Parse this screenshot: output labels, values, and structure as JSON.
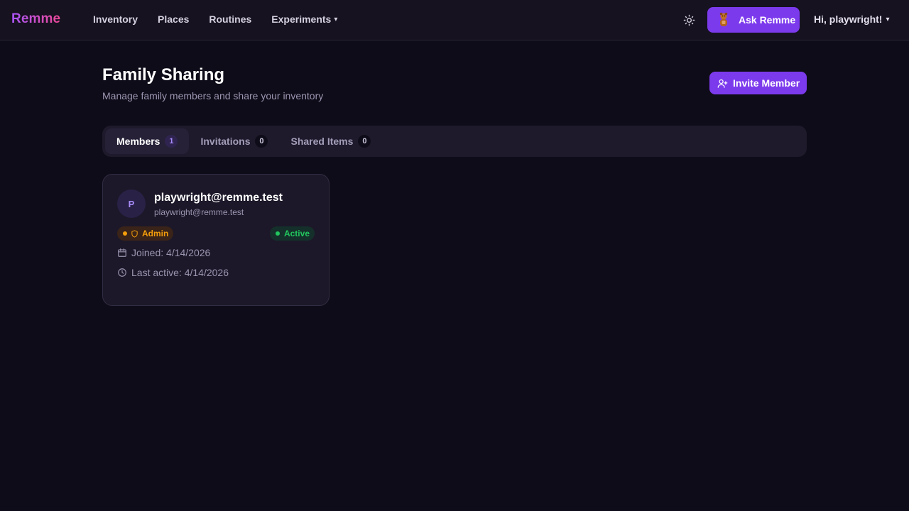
{
  "nav": {
    "brand": "Remme",
    "links": [
      {
        "label": "Inventory"
      },
      {
        "label": "Places"
      },
      {
        "label": "Routines"
      },
      {
        "label": "Experiments",
        "caret": "▾"
      }
    ],
    "theme_icon": "sun-icon",
    "ask_button_label": "Ask Remme",
    "user_greeting": "Hi, playwright!",
    "user_caret": "▾"
  },
  "header": {
    "title": "Family Sharing",
    "subtitle": "Manage family members and share your inventory",
    "invite_button_label": "Invite Member"
  },
  "tabs": [
    {
      "label": "Members",
      "count": "1",
      "active": true
    },
    {
      "label": "Invitations",
      "count": "0",
      "active": false
    },
    {
      "label": "Shared Items",
      "count": "0",
      "active": false
    }
  ],
  "member": {
    "initial": "P",
    "name": "playwright@remme.test",
    "email": "playwright@remme.test",
    "role": "Admin",
    "status": "Active",
    "joined": "Joined: 4/14/2026",
    "last_active": "Last active: 4/14/2026"
  },
  "colors": {
    "accent": "#7c3aed",
    "admin": "#f59e0b",
    "active": "#22c55e",
    "background": "#0f0c19"
  }
}
